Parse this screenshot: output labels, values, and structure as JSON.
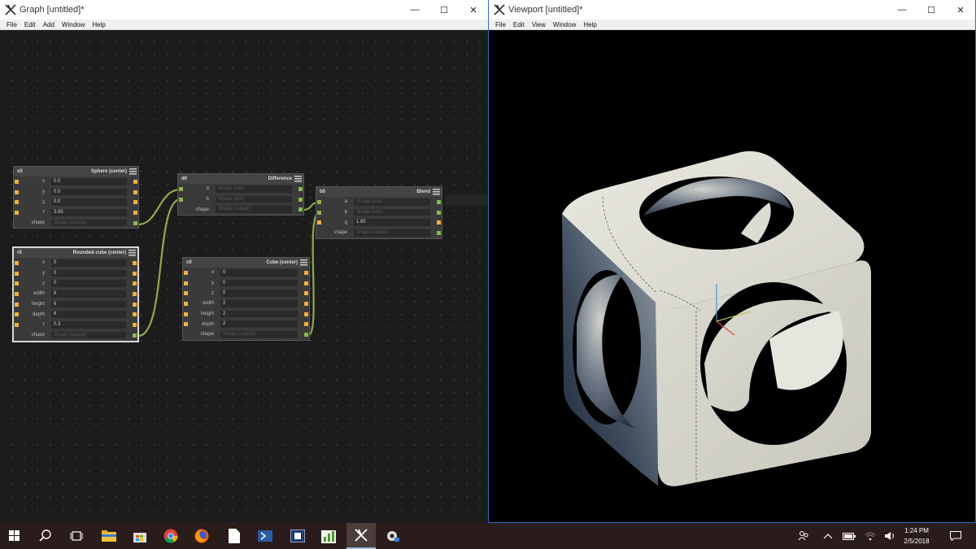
{
  "graph_window": {
    "title": "Graph [untitled]*",
    "menu": [
      "File",
      "Edit",
      "Add",
      "Window",
      "Help"
    ],
    "nodes": {
      "s0": {
        "id": "s0",
        "name": "Sphere (center)",
        "fields": [
          {
            "label": "x",
            "value": "0.0"
          },
          {
            "label": "y",
            "value": "0.0"
          },
          {
            "label": "z",
            "value": "0.0"
          },
          {
            "label": "r",
            "value": "3.85"
          },
          {
            "label": "shape",
            "value": "Shape (output)"
          }
        ]
      },
      "r0": {
        "id": "r0",
        "name": "Rounded cube (center)",
        "fields": [
          {
            "label": "x",
            "value": "0"
          },
          {
            "label": "y",
            "value": "0"
          },
          {
            "label": "z",
            "value": "0"
          },
          {
            "label": "width",
            "value": "6"
          },
          {
            "label": "height",
            "value": "6"
          },
          {
            "label": "depth",
            "value": "6"
          },
          {
            "label": "r",
            "value": "0.3"
          },
          {
            "label": "shape",
            "value": "Shape (output)"
          }
        ]
      },
      "d0": {
        "id": "d0",
        "name": "Difference",
        "fields": [
          {
            "label": "a",
            "value": "Shape (link)"
          },
          {
            "label": "b",
            "value": "Shape (link)"
          },
          {
            "label": "shape",
            "value": "Shape (output)"
          }
        ]
      },
      "c0": {
        "id": "c0",
        "name": "Cube (center)",
        "fields": [
          {
            "label": "x",
            "value": "0"
          },
          {
            "label": "y",
            "value": "0"
          },
          {
            "label": "z",
            "value": "0"
          },
          {
            "label": "width",
            "value": "2"
          },
          {
            "label": "height",
            "value": "2"
          },
          {
            "label": "depth",
            "value": "2"
          },
          {
            "label": "shape",
            "value": "Shape (output)"
          }
        ]
      },
      "b0": {
        "id": "b0",
        "name": "Blend",
        "fields": [
          {
            "label": "a",
            "value": "Shape (link)"
          },
          {
            "label": "b",
            "value": "Shape (link)"
          },
          {
            "label": "q",
            "value": "1.85"
          },
          {
            "label": "shape",
            "value": "Shape (output)"
          }
        ]
      }
    }
  },
  "viewport_window": {
    "title": "Viewport [untitled]*",
    "menu": [
      "File",
      "Edit",
      "View",
      "Window",
      "Help"
    ]
  },
  "window_controls": {
    "minimize": "—",
    "maximize": "☐",
    "close": "✕"
  },
  "taskbar": {
    "time": "1:24 PM",
    "date": "2/5/2018"
  },
  "colors": {
    "pin_input": "#f0b040",
    "pin_link": "#8ab84b",
    "wire": "#8fa84e",
    "selection": "#2f6fc4"
  }
}
